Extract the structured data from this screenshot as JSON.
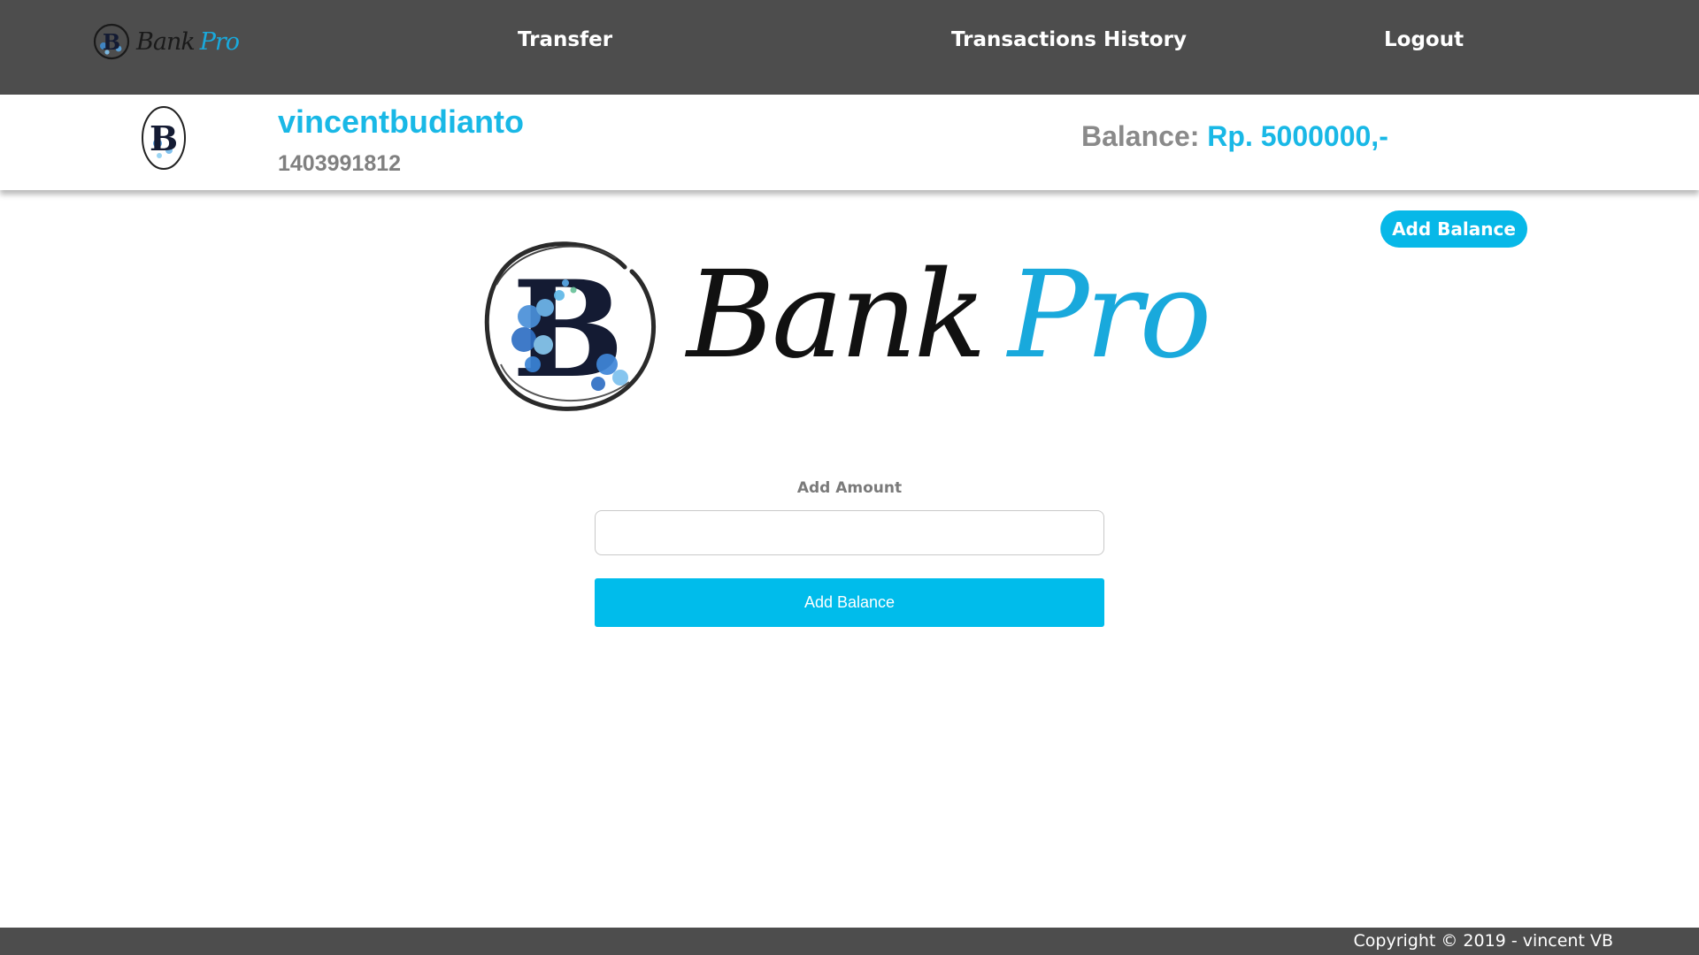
{
  "nav": {
    "logo_word1": "Bank",
    "logo_word2": "Pro",
    "transfer": "Transfer",
    "transactions_history": "Transactions History",
    "logout": "Logout"
  },
  "profile": {
    "username": "vincentbudianto",
    "account_number": "1403991812",
    "balance_label": "Balance: ",
    "balance_value": "Rp. 5000000,-"
  },
  "header_button": {
    "label": "Add Balance"
  },
  "brand": {
    "word1": "Bank",
    "word2": "Pro"
  },
  "form": {
    "amount_label": "Add Amount",
    "amount_value": "",
    "submit_label": "Add Balance"
  },
  "footer": {
    "copyright": "Copyright © 2019 - vincent VB"
  },
  "colors": {
    "navbar": "#4d4d4d",
    "accent": "#19b8e6",
    "button": "#00bceb",
    "muted_text": "#808080"
  },
  "icons": {
    "nav_logo": "bank-pro-logo-icon",
    "avatar": "user-avatar-logo-icon",
    "brand_mark": "floral-b-monogram-icon"
  }
}
